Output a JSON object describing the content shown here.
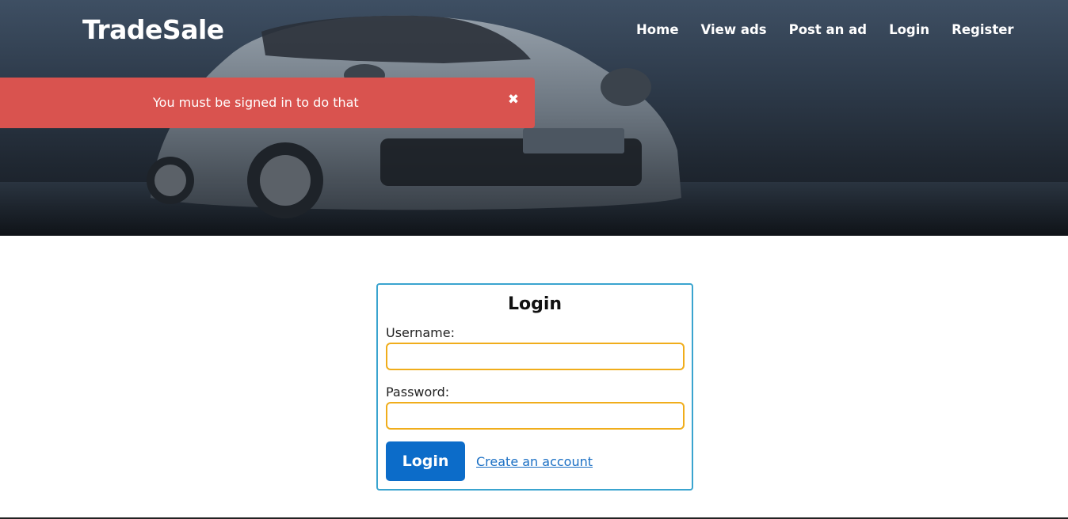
{
  "header": {
    "logo": "TradeSale",
    "nav": [
      "Home",
      "View ads",
      "Post an ad",
      "Login",
      "Register"
    ]
  },
  "alert": {
    "message": "You must be signed in to do that",
    "close_icon": "✖",
    "color": "#d9534f"
  },
  "login_form": {
    "title": "Login",
    "username_label": "Username:",
    "username_value": "",
    "password_label": "Password:",
    "password_value": "",
    "submit_label": "Login",
    "create_account_label": "Create an account"
  },
  "colors": {
    "primary_button": "#0c6cc9",
    "input_border": "#f0ad1b",
    "box_border": "#3aa4cf",
    "link": "#1a6fc4"
  }
}
